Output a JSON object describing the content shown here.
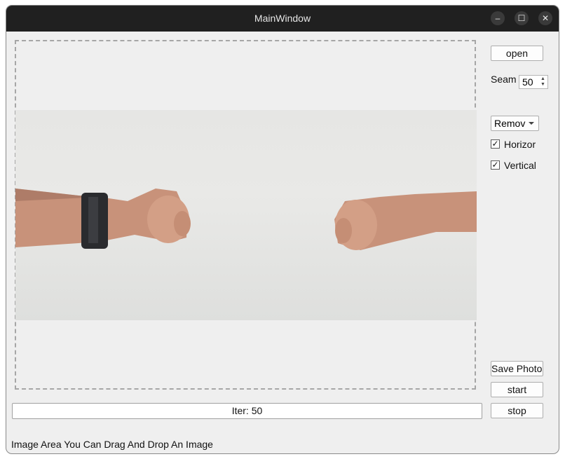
{
  "window": {
    "title": "MainWindow"
  },
  "controls": {
    "open_label": "open",
    "seam_label": "Seam",
    "seam_value": "50",
    "mode_value": "Remov",
    "horizontal_label": "Horizor",
    "horizontal_checked": true,
    "vertical_label": "Vertical",
    "vertical_checked": true,
    "save_label": "Save Photos",
    "start_label": "start",
    "stop_label": "stop"
  },
  "progress": {
    "text": "Iter: 50"
  },
  "status": {
    "text": "Image Area You Can Drag And Drop An Image"
  },
  "icons": {
    "minimize": "minimize-icon",
    "maximize": "maximize-icon",
    "close": "close-icon"
  }
}
